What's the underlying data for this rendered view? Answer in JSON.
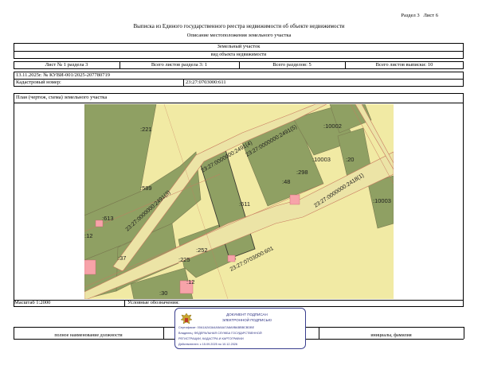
{
  "header": {
    "section": "Раздел 3",
    "sheet": "Лист 6",
    "title": "Выписка из Единого государственного реестра недвижимости об объекте недвижимости",
    "subtitle": "Описание местоположения земельного участка"
  },
  "object": {
    "type": "Земельный участок",
    "type_caption": "вид объекта недвижимости"
  },
  "sheet_info": {
    "sheet_label": "Лист № 1 раздела 3",
    "sheets_in_section": "Всего листов раздела 3: 1",
    "sections_total": "Всего разделов: 5",
    "sheets_total": "Всего листов выписки: 10"
  },
  "meta": {
    "date_number": "13.11.2025г. № КУВИ-001/2025-207780719",
    "cadastral_label": "Кадастровый номер:",
    "cadastral_number": "23:27:0703000:611"
  },
  "plan": {
    "title": "План (чертеж, схема) земельного участка",
    "parcel_labels": [
      ":221",
      ":589",
      ":613",
      ":12",
      ":37",
      ":225",
      ":252",
      ":12",
      ":30",
      ":611",
      ":48",
      ":298",
      ":10002",
      ":10003",
      ":20",
      ":10003"
    ],
    "road_labels": [
      "23:27:0000000:2491(4)",
      "23:27:0000000:2491(5)",
      "23:27:0000000:2491(3)",
      "23:27:0000000:2418(1)",
      "23:27:0703000:601"
    ],
    "colors": {
      "background": "#f1eaa4",
      "parcel": "#8fa063",
      "road": "#ece4a6",
      "building": "#f7a3a9",
      "boundary": "#c87a60"
    }
  },
  "footer": {
    "scale": "Масштаб 1:2000",
    "legend": "Условные обозначения:",
    "position_caption": "полное наименование должности",
    "name_caption": "инициалы, фамилия"
  },
  "stamp": {
    "line1": "ДОКУМЕНТ ПОДПИСАН",
    "line2": "ЭЛЕКТРОННОЙ ПОДПИСЬЮ",
    "cert": "Сертификат: 00А1А2А3А4А5А6А7А8А9ВАВВВСВDВЕ",
    "owner_line1": "Владелец: ФЕДЕРАЛЬНАЯ СЛУЖБА ГОСУДАРСТВЕННОЙ",
    "owner_line2": "РЕГИСТРАЦИИ, КАДАСТРА И КАРТОГРАФИИ",
    "valid": "Действителен: с 15.09.2025 по 10.12.2026"
  }
}
